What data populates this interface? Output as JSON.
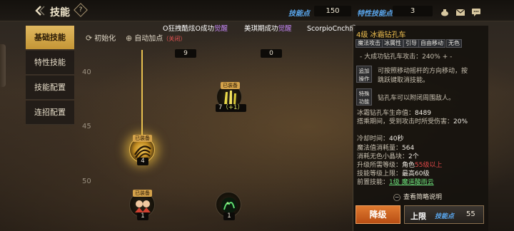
{
  "header": {
    "title": "技能",
    "skill_points_label": "技能点",
    "skill_points_value": "150",
    "trait_points_label": "特性技能点",
    "trait_points_value": "3"
  },
  "nav": [
    {
      "label": "基础技能",
      "active": true
    },
    {
      "label": "特性技能",
      "active": false
    },
    {
      "label": "技能配置",
      "active": false
    },
    {
      "label": "连招配置",
      "active": false
    }
  ],
  "notices": [
    {
      "prefix": "O狂拽酷炫O成功",
      "suffix": "觉醒"
    },
    {
      "prefix": "美琪期成功",
      "suffix": "觉醒"
    },
    {
      "prefix": "ScorpioCnch成",
      "suffix": ""
    }
  ],
  "tools": {
    "init": "初始化",
    "auto_add": "自动加点",
    "auto_state": "（关闭）"
  },
  "levels": [
    "40",
    "45",
    "50"
  ],
  "column_counts": [
    "9",
    "0"
  ],
  "skills": [
    {
      "equipped_tag": "已装备",
      "level": "7",
      "bonus": "（+1）"
    },
    {
      "equipped_tag": "已装备",
      "level": "4",
      "bonus": ""
    },
    {
      "equipped_tag": "已装备",
      "level": "1",
      "bonus": ""
    },
    {
      "equipped_tag": "",
      "level": "1",
      "bonus": ""
    }
  ],
  "detail": {
    "name": "4级 冰霜钻孔车",
    "tags": [
      "魔法攻击",
      "冰属性",
      "引导",
      "自由移动",
      "无色"
    ],
    "attack_line": "- 大成功钻孔车攻击：240% + -",
    "op1_btn": "追加操作",
    "op1_text_1": "可按照移动摇杆的方向移动，按",
    "op1_text_2": "跳跃键取消技能。",
    "op2_btn": "特殊功能",
    "op2_text": "钻孔车可以附闭周围敌人。",
    "hp_label": "冰霜钻孔车生命值：",
    "hp_value": "8489",
    "dmg_label": "搭乘期间，受到攻击时所受伤害：",
    "dmg_value": "20%",
    "cooldown_label": "冷却时间：",
    "cooldown_value": "40秒",
    "mp_label": "魔法值消耗量：",
    "mp_value": "564",
    "crystal_label": "消耗无色小晶块：",
    "crystal_value": "2个",
    "req_label": "升级所需等级：",
    "req_mid": "角色",
    "req_value": "55级以上",
    "max_label": "技能等级上限：",
    "max_value": "最高60级",
    "pre_label": "前置技能：",
    "pre_value": "1级 魔道酸雨云",
    "brief": "查看简略说明",
    "down_btn": "降级",
    "up_btn": "上限",
    "up_points_label": "技能点",
    "up_points_value": "55"
  },
  "colors": {
    "accent_gold": "#e0b860",
    "skill_points_blue": "#5aa8f0",
    "awaken_purple": "#c084f0",
    "warning_red": "#e04848",
    "link_green": "#6ce07a",
    "down_orange": "#d86a24"
  }
}
